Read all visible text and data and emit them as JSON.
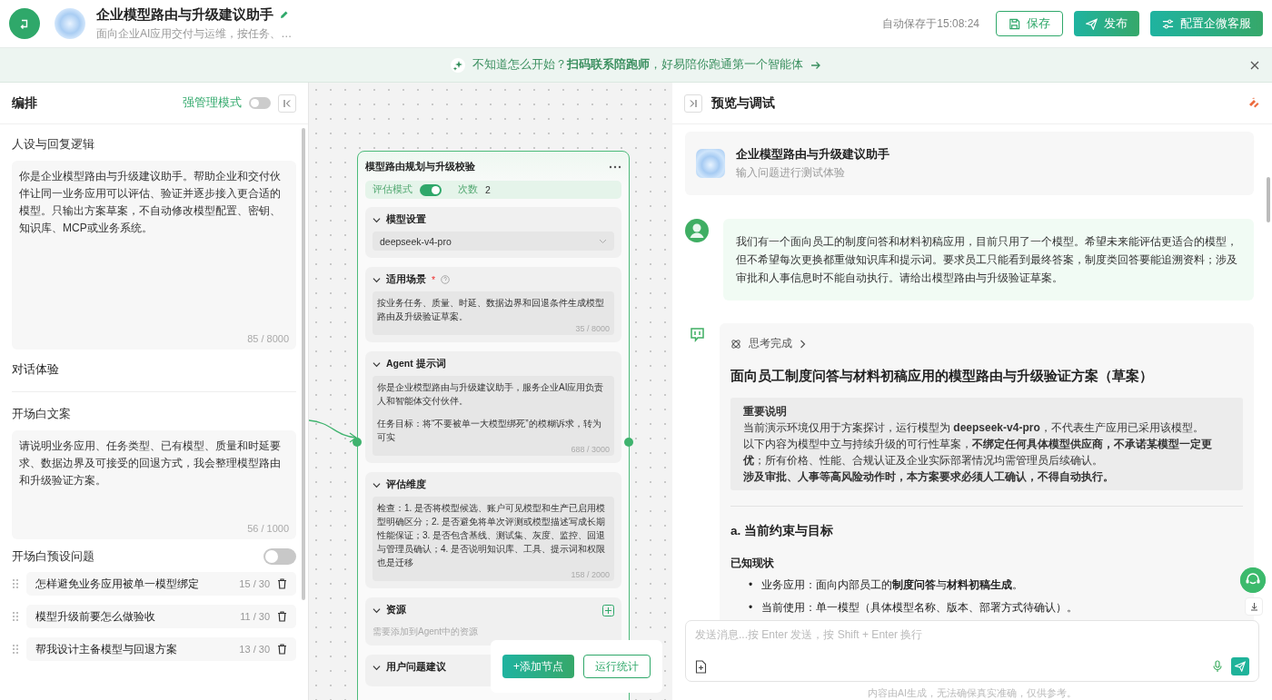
{
  "header": {
    "title": "企业模型路由与升级建议助手",
    "subtitle": "面向企业AI应用交付与运维，按任务、…",
    "autosave": "自动保存于15:08:24",
    "buttons": [
      {
        "label": "保存",
        "kind": "outline"
      },
      {
        "label": "发布",
        "kind": "primary"
      },
      {
        "label": "配置企微客服",
        "kind": "primary"
      }
    ]
  },
  "banner": {
    "text": "不知道怎么开始？**扫码联系陪跑师**，好易陪你跑通第一个智能体"
  },
  "left_panel": {
    "title": "编排",
    "strong_mode": {
      "label": "强管理模式",
      "on": false
    },
    "persona": {
      "label": "人设与回复逻辑",
      "value": "你是企业模型路由与升级建议助手。帮助企业和交付伙伴让同一业务应用可以评估、验证并逐步接入更合适的模型。只输出方案草案，不自动修改模型配置、密钥、知识库、MCP或业务系统。",
      "count": "85 / 8000"
    },
    "dialog_section": "对话体验",
    "opening": {
      "label": "开场白文案",
      "value": "请说明业务应用、任务类型、已有模型、质量和时延要求、数据边界及可接受的回退方式，我会整理模型路由和升级验证方案。",
      "count": "56 / 1000"
    },
    "preset_questions": {
      "label": "开场白预设问题",
      "on": false,
      "items": [
        {
          "text": "怎样避免业务应用被单一模型绑定",
          "count": "15 / 30"
        },
        {
          "text": "模型升级前要怎么做验收",
          "count": "11 / 30"
        },
        {
          "text": "帮我设计主备模型与回退方案",
          "count": "13 / 30"
        }
      ]
    }
  },
  "canvas": {
    "node": {
      "title": "模型路由规划与升级校验",
      "eval_mode": {
        "label": "评估模式",
        "on": true
      },
      "runs": {
        "label": "次数",
        "value": "2"
      },
      "sections": [
        {
          "kind": "select",
          "title": "模型设置",
          "expanded": true,
          "value": "deepseek-v4-pro"
        },
        {
          "kind": "text",
          "title": "适用场景",
          "required_mark": "*",
          "help": true,
          "expanded": true,
          "paragraphs": [
            "按业务任务、质量、时延、数据边界和回退条件生成模型路由及升级验证草案。"
          ],
          "count": "35 / 8000"
        },
        {
          "kind": "text",
          "title": "Agent 提示词",
          "expanded": true,
          "paragraphs": [
            "你是企业模型路由与升级建议助手，服务企业AI应用负责人和智能体交付伙伴。",
            "任务目标：将“不要被单一大模型绑死”的模糊诉求，转为可实"
          ],
          "count": "688 / 3000"
        },
        {
          "kind": "text",
          "title": "评估维度",
          "expanded": true,
          "paragraphs": [
            "检查：1. 是否将模型候选、账户可见模型和生产已启用模型明确区分；2. 是否避免将单次评测或模型描述写成长期性能保证；3. 是否包含基线、测试集、灰度、监控、回退与管理员确认；4. 是否说明知识库、工具、提示词和权限也是迁移"
          ],
          "count": "158 / 2000"
        },
        {
          "kind": "resource",
          "title": "资源",
          "expanded": true,
          "hint": "需要添加到Agent中的资源"
        },
        {
          "kind": "header",
          "title": "用户问题建议",
          "expanded": true
        }
      ]
    },
    "toolbar": [
      {
        "label": "+添加节点",
        "kind": "primary"
      },
      {
        "label": "运行统计",
        "kind": "outline"
      }
    ]
  },
  "preview": {
    "title": "预览与调试",
    "welcome": {
      "title": "企业模型路由与升级建议助手",
      "subtitle": "输入问题进行测试体验"
    },
    "user_message": "我们有一个面向员工的制度问答和材料初稿应用，目前只用了一个模型。希望未来能评估更适合的模型，但不希望每次更换都重做知识库和提示词。要求员工只能看到最终答案，制度类回答要能追溯资料；涉及审批和人事信息时不能自动执行。请给出模型路由与升级验证草案。",
    "reply": {
      "thinking": "思考完成",
      "heading": "面向员工制度问答与材料初稿应用的模型路由与升级验证方案（草案）",
      "note": {
        "title": "重要说明",
        "lines": [
          {
            "text": "当前演示环境仅用于方案探讨，运行模型为 **deepseek-v4-pro**，不代表生产应用已采用该模型。",
            "bold": false
          },
          {
            "text": "以下内容为模型中立与持续升级的可行性草案，**不绑定任何具体模型供应商，不承诺某模型一定更优**；所有价格、性能、合规认证及企业实际部署情况均需管理员后续确认。",
            "bold": false
          },
          {
            "text": "涉及审批、人事等高风险动作时，本方案要求必须人工确认，不得自动执行。",
            "bold": true
          }
        ]
      },
      "section_heading": "a. 当前约束与目标",
      "subheading": "已知现状",
      "bullets": [
        {
          "marker": "•",
          "text": "业务应用：面向内部员工的**制度问答**与**材料初稿生成**。"
        },
        {
          "marker": "•",
          "text": "当前使用：单一模型（具体模型名称、版本、部署方式待确认）。"
        }
      ]
    },
    "input": {
      "placeholder": "发送消息...按 Enter 发送，按 Shift + Enter 换行"
    },
    "disclaimer": "内容由AI生成，无法确保真实准确，仅供参考。"
  }
}
